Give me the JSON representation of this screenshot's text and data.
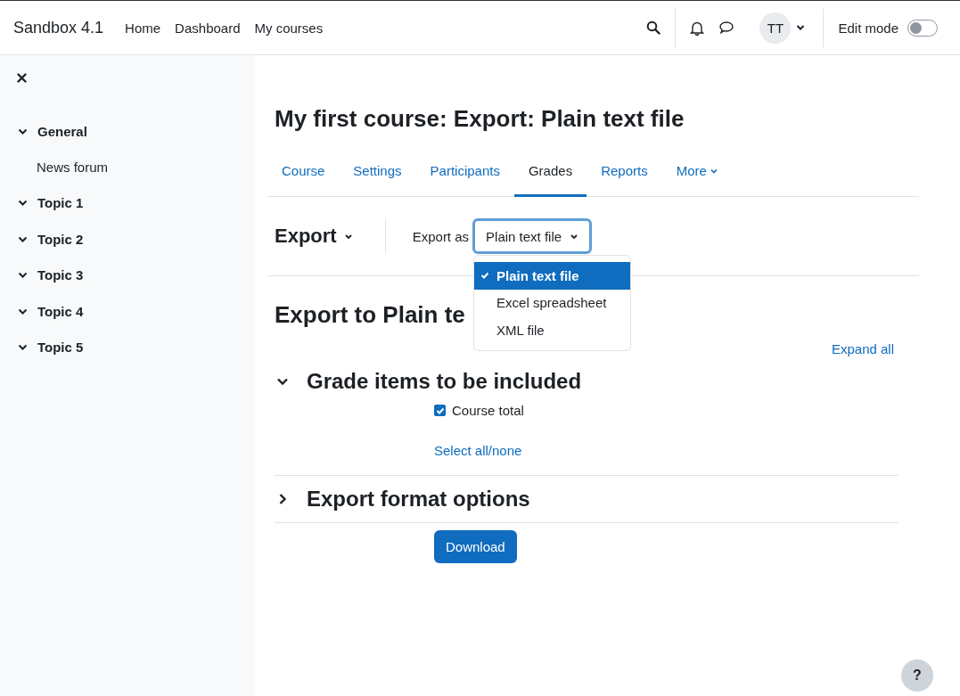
{
  "navbar": {
    "brand": "Sandbox 4.1",
    "links": [
      "Home",
      "Dashboard",
      "My courses"
    ],
    "avatar": "TT",
    "edit_mode": {
      "label": "Edit mode",
      "on": false
    }
  },
  "sidebar": {
    "items": [
      {
        "label": "General",
        "expanded": true,
        "children": [
          {
            "label": "News forum"
          }
        ]
      },
      {
        "label": "Topic 1",
        "expanded": true
      },
      {
        "label": "Topic 2",
        "expanded": true
      },
      {
        "label": "Topic 3",
        "expanded": true
      },
      {
        "label": "Topic 4",
        "expanded": true
      },
      {
        "label": "Topic 5",
        "expanded": true
      }
    ]
  },
  "page_title": "My first course: Export: Plain text file",
  "tabs": [
    {
      "label": "Course",
      "selected": false,
      "kind": "link"
    },
    {
      "label": "Settings",
      "selected": false,
      "kind": "link"
    },
    {
      "label": "Participants",
      "selected": false,
      "kind": "link"
    },
    {
      "label": "Grades",
      "selected": true,
      "kind": "link"
    },
    {
      "label": "Reports",
      "selected": false,
      "kind": "link"
    },
    {
      "label": "More",
      "selected": false,
      "kind": "menu"
    }
  ],
  "action_bar": {
    "menu": "Export",
    "select_label": "Export as",
    "select_value": "Plain text file",
    "options": [
      {
        "label": "Plain text file",
        "selected": true
      },
      {
        "label": "Excel spreadsheet",
        "selected": false
      },
      {
        "label": "XML file",
        "selected": false
      }
    ]
  },
  "heading": "Export to Plain te",
  "expand_all": "Expand all",
  "sections": [
    {
      "title": "Grade items to be included",
      "expanded": true,
      "items": [
        {
          "label": "Course total",
          "checked": true
        }
      ],
      "link": "Select all/none"
    },
    {
      "title": "Export format options",
      "expanded": false
    }
  ],
  "download": "Download",
  "help": "?"
}
